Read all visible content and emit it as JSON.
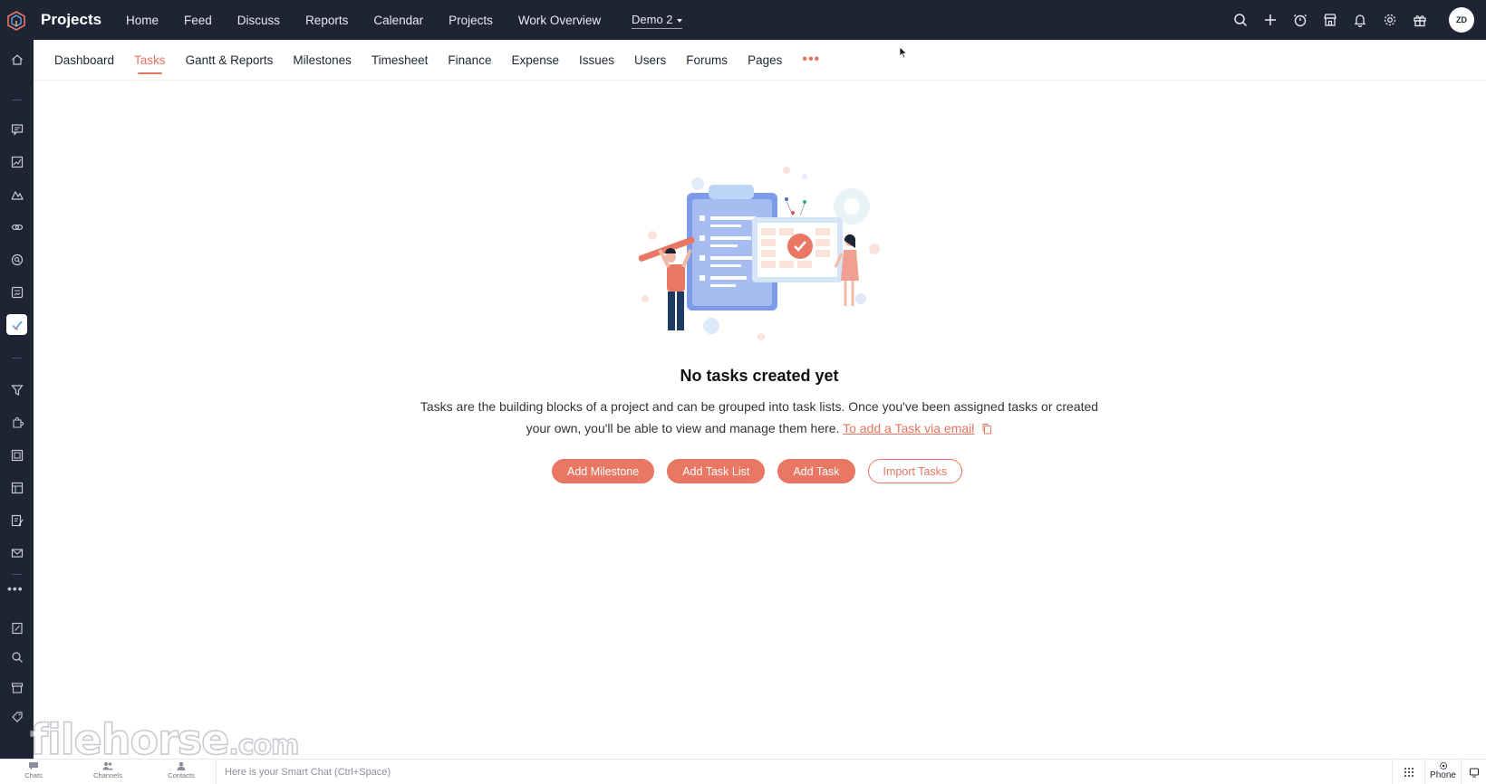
{
  "header": {
    "app_title": "Projects",
    "nav": [
      "Home",
      "Feed",
      "Discuss",
      "Reports",
      "Calendar",
      "Projects",
      "Work Overview"
    ],
    "portal": "Demo 2",
    "icons": [
      "search-icon",
      "add-icon",
      "timer-icon",
      "store-icon",
      "bell-icon",
      "gear-icon",
      "gift-icon"
    ],
    "avatar_initials": "ZD"
  },
  "subnav": {
    "tabs": [
      "Dashboard",
      "Tasks",
      "Gantt & Reports",
      "Milestones",
      "Timesheet",
      "Finance",
      "Expense",
      "Issues",
      "Users",
      "Forums",
      "Pages"
    ],
    "active": "Tasks",
    "more": "•••"
  },
  "empty_state": {
    "title": "No tasks created yet",
    "description": "Tasks are the building blocks of a project and can be grouped into task lists. Once you've been assigned tasks or created your own, you'll be able to view and manage them here.",
    "email_link": "To add a Task via email",
    "buttons": {
      "add_milestone": "Add Milestone",
      "add_task_list": "Add Task List",
      "add_task": "Add Task",
      "import_tasks": "Import Tasks"
    }
  },
  "chatbar": {
    "tabs": [
      "Chats",
      "Channels",
      "Contacts"
    ],
    "placeholder": "Here is your Smart Chat (Ctrl+Space)",
    "phone_label": "Phone"
  },
  "watermark": {
    "main": "filehorse",
    "suffix": ".com"
  },
  "colors": {
    "header_bg": "#1e2434",
    "accent": "#e3755f",
    "button_fill": "#e97763"
  }
}
